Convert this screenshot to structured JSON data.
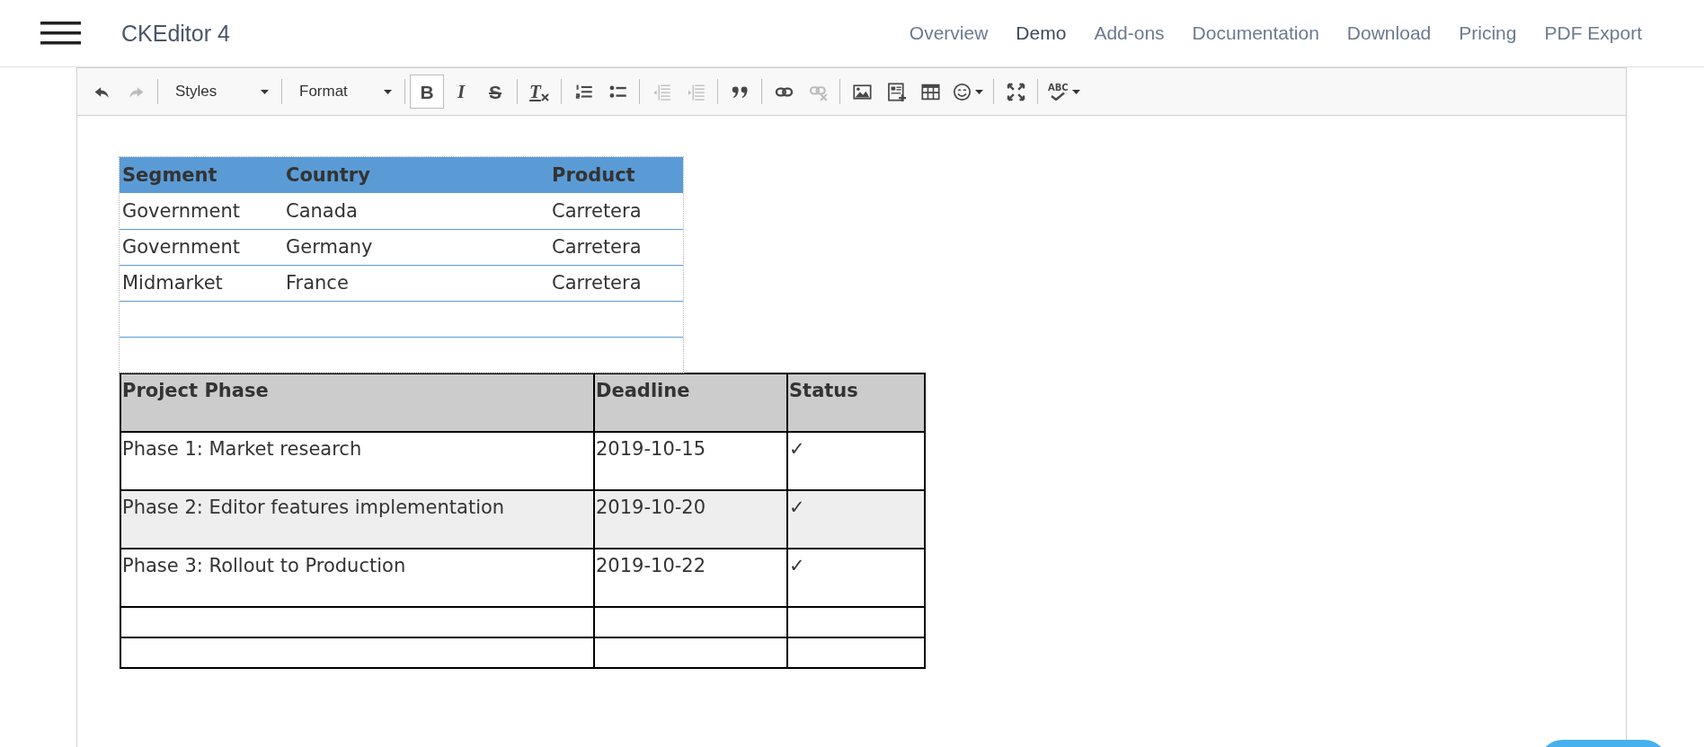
{
  "header": {
    "logo": "CKEditor 4",
    "nav": [
      {
        "label": "Overview",
        "selected": false
      },
      {
        "label": "Demo",
        "selected": true
      },
      {
        "label": "Add-ons",
        "selected": false
      },
      {
        "label": "Documentation",
        "selected": false
      },
      {
        "label": "Download",
        "selected": false
      },
      {
        "label": "Pricing",
        "selected": false
      },
      {
        "label": "PDF Export",
        "selected": false
      }
    ]
  },
  "toolbar": {
    "groups": [
      {
        "items": [
          {
            "kind": "undo",
            "on": false,
            "disabled": false
          },
          {
            "kind": "redo",
            "on": false,
            "disabled": true
          }
        ]
      },
      {
        "items": [
          {
            "kind": "combo",
            "label": "Styles"
          }
        ]
      },
      {
        "items": [
          {
            "kind": "combo",
            "label": "Format"
          }
        ]
      },
      {
        "items": [
          {
            "kind": "bold",
            "glyph": "B",
            "on": true,
            "disabled": false
          },
          {
            "kind": "italic",
            "glyph": "I",
            "on": false,
            "disabled": false
          },
          {
            "kind": "strike",
            "glyph": "S",
            "on": false,
            "disabled": false
          }
        ]
      },
      {
        "items": [
          {
            "kind": "removeformat",
            "glyph": "T",
            "on": false,
            "disabled": false
          }
        ]
      },
      {
        "items": [
          {
            "kind": "numberedlist",
            "on": false,
            "disabled": false
          },
          {
            "kind": "bulletedlist",
            "on": false,
            "disabled": false
          }
        ]
      },
      {
        "items": [
          {
            "kind": "outdent",
            "on": false,
            "disabled": true
          },
          {
            "kind": "indent",
            "on": false,
            "disabled": true
          }
        ]
      },
      {
        "items": [
          {
            "kind": "blockquote",
            "on": false,
            "disabled": false
          }
        ]
      },
      {
        "items": [
          {
            "kind": "link",
            "on": false,
            "disabled": false
          },
          {
            "kind": "unlink",
            "on": false,
            "disabled": true
          }
        ]
      },
      {
        "items": [
          {
            "kind": "image",
            "on": false,
            "disabled": false
          },
          {
            "kind": "template",
            "on": false,
            "disabled": false
          },
          {
            "kind": "table",
            "on": false,
            "disabled": false
          },
          {
            "kind": "smiley",
            "on": false,
            "disabled": false
          }
        ]
      },
      {
        "items": [
          {
            "kind": "maximize",
            "on": false,
            "disabled": false
          }
        ]
      },
      {
        "items": [
          {
            "kind": "spellcheck",
            "glyph": "ABC",
            "on": false,
            "disabled": false
          }
        ]
      }
    ]
  },
  "sales_table": {
    "columns": [
      "Segment",
      "Country",
      "Product"
    ],
    "rows": [
      {
        "cells": [
          "Government",
          "Canada",
          "Carretera"
        ]
      },
      {
        "cells": [
          "Government",
          "Germany",
          "Carretera"
        ]
      },
      {
        "cells": [
          "Midmarket",
          "France",
          "Carretera"
        ]
      },
      {},
      {}
    ]
  },
  "project_table": {
    "columns": [
      "Project Phase",
      "Deadline",
      "Status"
    ],
    "rows": [
      {
        "cells": [
          "Phase 1: Market research",
          "2019-10-15",
          "✓"
        ],
        "shaded": false
      },
      {
        "cells": [
          "Phase 2: Editor features implementation",
          "2019-10-20",
          "✓"
        ],
        "shaded": true
      },
      {
        "cells": [
          "Phase 3: Rollout to Production",
          "2019-10-22",
          "✓"
        ],
        "shaded": false
      },
      {
        "shaded": false
      },
      {
        "shaded": false
      }
    ]
  }
}
